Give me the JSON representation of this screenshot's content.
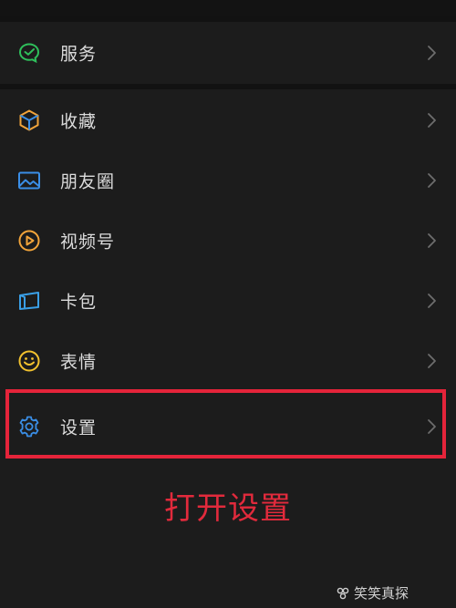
{
  "menu": {
    "services": {
      "label": "服务",
      "icon": "services-icon"
    },
    "items": [
      {
        "label": "收藏",
        "icon": "favorites-cube-icon",
        "color": "#f2a43a"
      },
      {
        "label": "朋友圈",
        "icon": "moments-picture-icon",
        "color": "#3a8ee6"
      },
      {
        "label": "视频号",
        "icon": "channels-play-icon",
        "color": "#f2a43a"
      },
      {
        "label": "卡包",
        "icon": "card-wallet-icon",
        "color": "#3a9fe6"
      },
      {
        "label": "表情",
        "icon": "sticker-smile-icon",
        "color": "#f2c12e"
      },
      {
        "label": "设置",
        "icon": "settings-gear-icon",
        "color": "#3a8ee6"
      }
    ]
  },
  "annotation": {
    "text": "打开设置",
    "color": "#e22a3c"
  },
  "watermark": {
    "text": "笑笑真探"
  },
  "colors": {
    "background": "#121212",
    "row_background": "#1c1c1c",
    "highlight": "#e5243a",
    "services_green": "#2fbf5b"
  }
}
